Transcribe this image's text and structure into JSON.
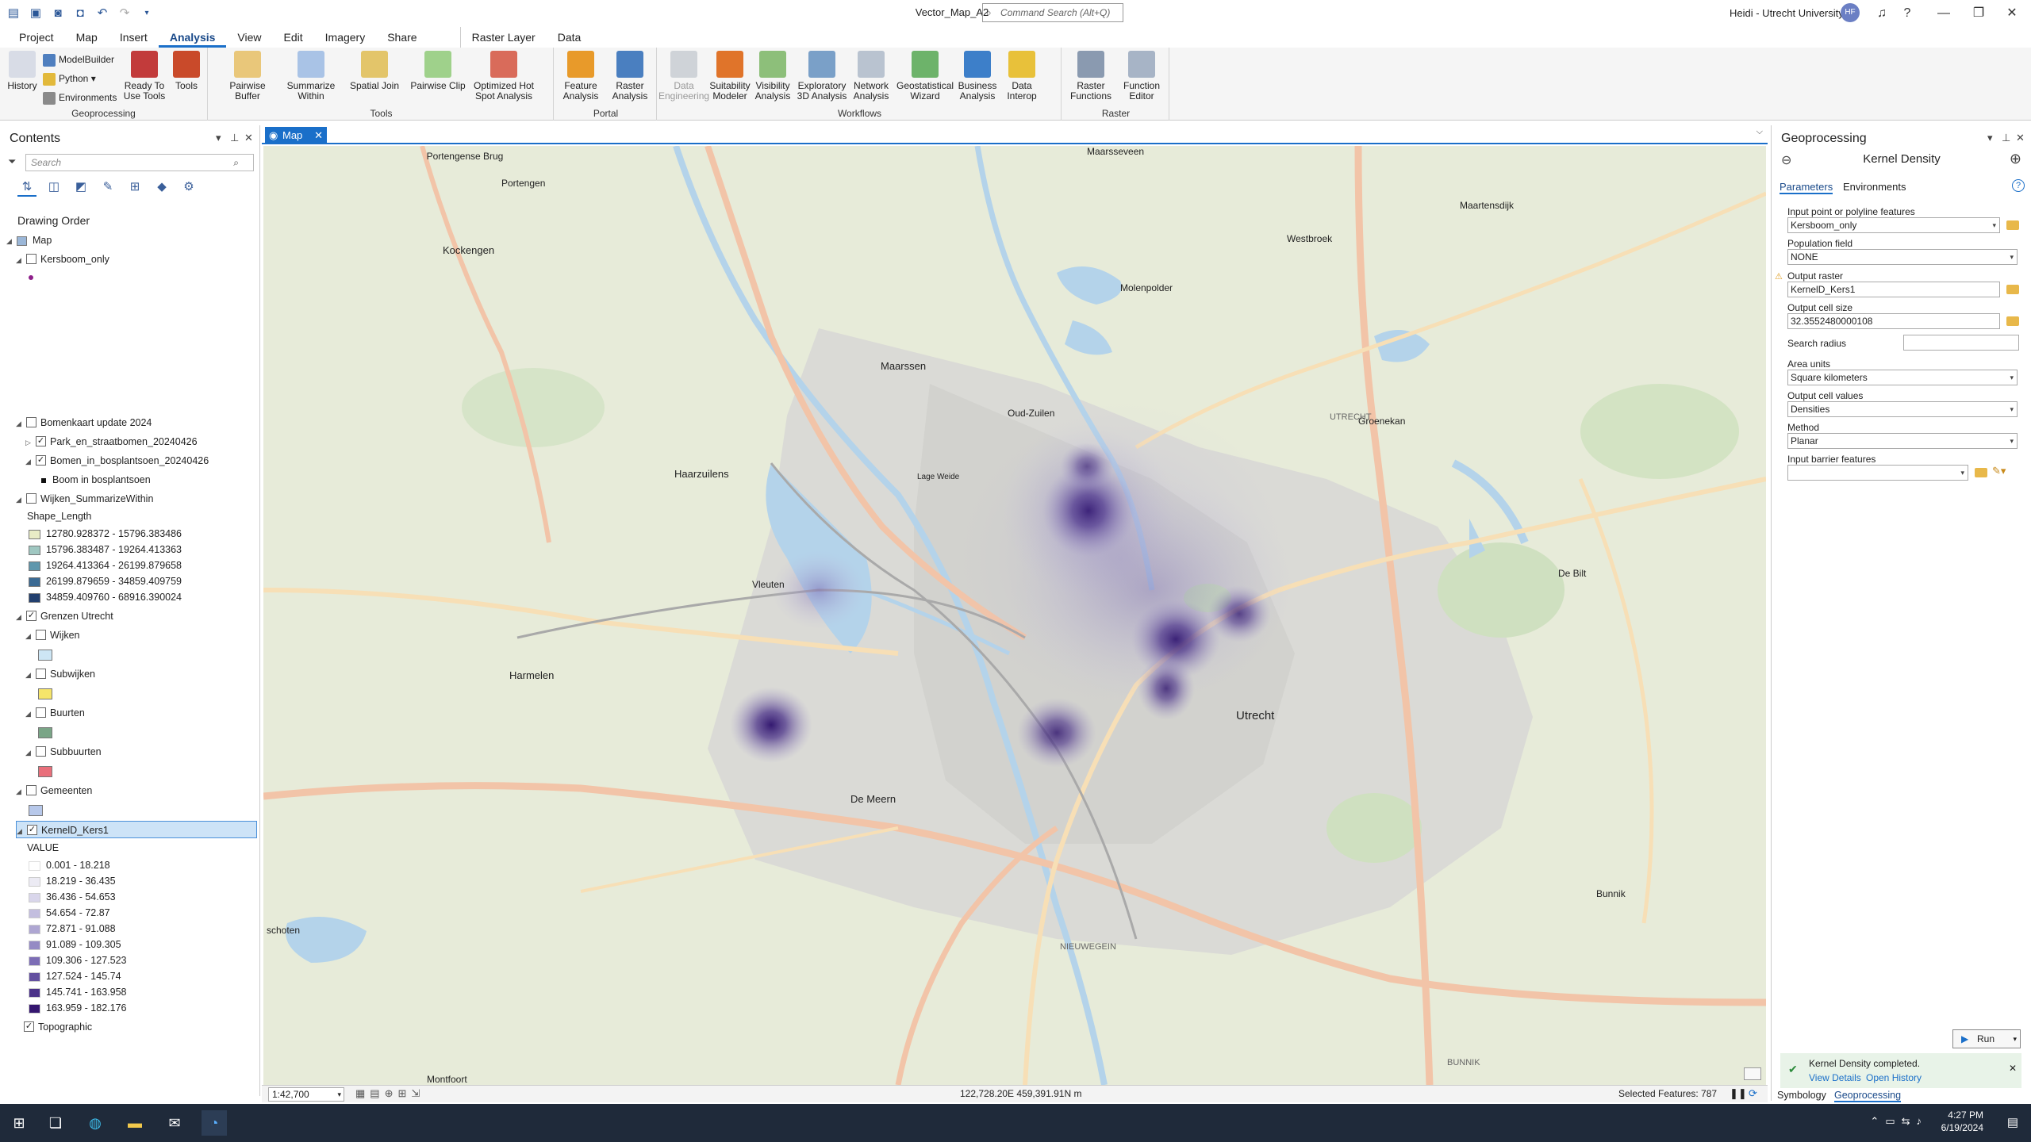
{
  "titlebar": {
    "document_title": "Vector_Map_A2",
    "command_search_placeholder": "Command Search (Alt+Q)",
    "user_name": "Heidi - Utrecht University",
    "user_initials": "HF"
  },
  "ribbon_tabs": [
    "Project",
    "Map",
    "Insert",
    "Analysis",
    "View",
    "Edit",
    "Imagery",
    "Share",
    "Raster Layer",
    "Data"
  ],
  "ribbon_active_tab": "Analysis",
  "ribbon": {
    "geoprocessing": {
      "label": "Geoprocessing",
      "history": "History",
      "modelbuilder": "ModelBuilder",
      "python": "Python",
      "environments": "Environments",
      "ready_to_use_tools": "Ready To Use Tools",
      "tools": "Tools"
    },
    "tools": {
      "label": "Tools",
      "items": [
        "Pairwise Buffer",
        "Summarize Within",
        "Spatial Join",
        "Pairwise Clip",
        "Optimized Hot Spot Analysis"
      ]
    },
    "portal": {
      "label": "Portal",
      "items": [
        "Feature Analysis",
        "Raster Analysis"
      ]
    },
    "workflows": {
      "label": "Workflows",
      "items": [
        "Data Engineering",
        "Suitability Modeler",
        "Visibility Analysis",
        "Exploratory 3D Analysis",
        "Network Analysis",
        "Geostatistical Wizard",
        "Business Analysis",
        "Data Interop"
      ]
    },
    "raster": {
      "label": "Raster",
      "items": [
        "Raster Functions",
        "Function Editor"
      ]
    }
  },
  "contents": {
    "title": "Contents",
    "search_placeholder": "Search",
    "drawing_order": "Drawing Order",
    "map": "Map",
    "layers": {
      "kersboom": "Kersboom_only",
      "bomenkaart": "Bomenkaart update 2024",
      "park": "Park_en_straatbomen_20240426",
      "bomen_bosplantsoen": "Bomen_in_bosplantsoen_20240426",
      "boom_legend": "Boom in bosplantsoen",
      "wijken_summarize": "Wijken_SummarizeWithin",
      "shape_length": "Shape_Length",
      "grenzen": "Grenzen Utrecht",
      "wijken": "Wijken",
      "subwijken": "Subwijken",
      "buurten": "Buurten",
      "subbuurten": "Subbuurten",
      "gemeenten": "Gemeenten",
      "kerneld": "KernelD_Kers1",
      "value": "VALUE",
      "topographic": "Topographic"
    },
    "shape_classes": [
      {
        "label": "12780.928372 - 15796.383486",
        "color": "#e9ecc6"
      },
      {
        "label": "15796.383487 - 19264.413363",
        "color": "#9fc7c1"
      },
      {
        "label": "19264.413364 - 26199.879658",
        "color": "#5f97ad"
      },
      {
        "label": "26199.879659 - 34859.409759",
        "color": "#3b6a93"
      },
      {
        "label": "34859.409760 - 68916.390024",
        "color": "#223f6e"
      }
    ],
    "value_classes": [
      {
        "label": "0.001 - 18.218",
        "color": "#ffffff"
      },
      {
        "label": "18.219 - 36.435",
        "color": "#ecebf4"
      },
      {
        "label": "36.436 - 54.653",
        "color": "#d9d6eb"
      },
      {
        "label": "54.654 - 72.87",
        "color": "#c3bedf"
      },
      {
        "label": "72.871 - 91.088",
        "color": "#aea6d2"
      },
      {
        "label": "91.089 - 109.305",
        "color": "#958ac4"
      },
      {
        "label": "109.306 - 127.523",
        "color": "#7c6db5"
      },
      {
        "label": "127.524 - 145.74",
        "color": "#63509f"
      },
      {
        "label": "145.741 - 163.958",
        "color": "#4b3289"
      },
      {
        "label": "163.959 - 182.176",
        "color": "#34166f"
      }
    ],
    "swatch_colors": {
      "wijken": "#cde6f5",
      "subwijken": "#f6e56a",
      "buurten": "#7aa587",
      "subbuurten": "#e96f7b",
      "gemeenten": "#b7c8ea",
      "kersboom_point": "#8e1f8a"
    }
  },
  "map_tab": "Map",
  "map_labels": {
    "portengen_brug": "Portengense Brug",
    "portengen": "Portengen",
    "kockengen": "Kockengen",
    "maarsseveen": "Maarsseveen",
    "westbroek": "Westbroek",
    "maartensdijk": "Maartensdijk",
    "molenpolder": "Molenpolder",
    "maarssen": "Maarssen",
    "oud_zuilen": "Oud-Zuilen",
    "groenekan": "Groenekan",
    "haarzuilens": "Haarzuilens",
    "lage_weide": "Lage Weide",
    "vleuten": "Vleuten",
    "de_bilt": "De Bilt",
    "harmelen": "Harmelen",
    "utrecht": "Utrecht",
    "de_meern": "De Meern",
    "bunnik": "Bunnik",
    "montfoort": "Montfoort",
    "schoten": "schoten",
    "nieuwegein": "NIEUWEGEIN",
    "bunnik_cap": "BUNNIK",
    "utrecht_cap": "UTRECHT"
  },
  "map_status": {
    "scale": "1:42,700",
    "coordinates": "122,728.20E 459,391.91N m",
    "selected_features": "Selected Features: 787"
  },
  "geoprocessing": {
    "title": "Geoprocessing",
    "tool": "Kernel Density",
    "tab_parameters": "Parameters",
    "tab_environments": "Environments",
    "input_label": "Input point or polyline features",
    "input_value": "Kersboom_only",
    "population_label": "Population field",
    "population_value": "NONE",
    "output_raster_label": "Output raster",
    "output_raster_value": "KernelD_Kers1",
    "cell_size_label": "Output cell size",
    "cell_size_value": "32.3552480000108",
    "search_radius_label": "Search radius",
    "search_radius_value": "",
    "area_units_label": "Area units",
    "area_units_value": "Square kilometers",
    "cell_values_label": "Output cell values",
    "cell_values_value": "Densities",
    "method_label": "Method",
    "method_value": "Planar",
    "barrier_label": "Input barrier features",
    "barrier_value": "",
    "run": "Run",
    "message": "Kernel Density completed.",
    "view_details": "View Details",
    "open_history": "Open History"
  },
  "bottom_tabs": [
    "Symbology",
    "Geoprocessing"
  ],
  "clock": {
    "time": "4:27 PM",
    "date": "6/19/2024"
  }
}
